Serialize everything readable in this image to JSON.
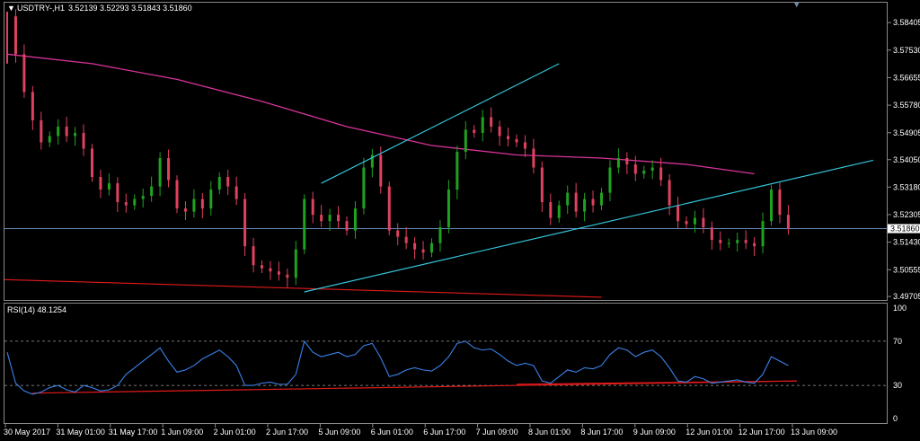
{
  "header": {
    "symbol": "USDTRY-,H1",
    "ohlc": "3.52139 3.52293 3.51843 3.51860"
  },
  "indicator": {
    "label": "RSI(14) 48.1254",
    "levels": [
      100,
      70,
      30,
      0
    ],
    "level_labels": [
      "100",
      "70",
      "30",
      "0"
    ]
  },
  "colors": {
    "background": "#000000",
    "bull": "#1fa31f",
    "bear": "#e0415f",
    "ma": "#d8339a",
    "trendline": "#33c5d8",
    "red_line": "#e31a1a",
    "rsi": "#3a82e8",
    "grid": "#9a9a9a",
    "price_line": "#5f86b2",
    "current_price_bg": "#ffffff"
  },
  "chart_data": {
    "type": "candlestick",
    "title": "USDTRY-,H1",
    "price_ticks": [
      "3.58405",
      "3.57530",
      "3.56655",
      "3.55780",
      "3.54905",
      "3.54050",
      "3.53180",
      "3.52305",
      "3.51430",
      "3.50555",
      "3.49705"
    ],
    "price_values": [
      3.58405,
      3.5753,
      3.56655,
      3.5578,
      3.54905,
      3.5405,
      3.5318,
      3.52305,
      3.5143,
      3.50555,
      3.49705
    ],
    "current_price": "3.51860",
    "ylim": [
      3.4965,
      3.5895
    ],
    "x_labels": [
      "30 May 2017",
      "31 May 01:00",
      "31 May 17:00",
      "1 Jun 09:00",
      "2 Jun 01:00",
      "2 Jun 17:00",
      "5 Jun 09:00",
      "6 Jun 01:00",
      "6 Jun 17:00",
      "7 Jun 09:00",
      "8 Jun 01:00",
      "8 Jun 17:00",
      "9 Jun 09:00",
      "12 Jun 01:00",
      "12 Jun 17:00",
      "13 Jun 09:00"
    ],
    "close_path": [
      [
        0,
        3.586
      ],
      [
        1,
        3.574
      ],
      [
        2,
        3.562
      ],
      [
        3,
        3.553
      ],
      [
        4,
        3.546
      ],
      [
        5,
        3.548
      ],
      [
        6,
        3.551
      ],
      [
        7,
        3.548
      ],
      [
        8,
        3.549
      ],
      [
        9,
        3.544
      ],
      [
        10,
        3.535
      ],
      [
        11,
        3.531
      ],
      [
        12,
        3.533
      ],
      [
        13,
        3.527
      ],
      [
        14,
        3.526
      ],
      [
        15,
        3.528
      ],
      [
        16,
        3.529
      ],
      [
        17,
        3.532
      ],
      [
        18,
        3.541
      ],
      [
        19,
        3.534
      ],
      [
        20,
        3.525
      ],
      [
        21,
        3.524
      ],
      [
        22,
        3.528
      ],
      [
        23,
        3.525
      ],
      [
        24,
        3.531
      ],
      [
        25,
        3.535
      ],
      [
        26,
        3.532
      ],
      [
        27,
        3.528
      ],
      [
        28,
        3.513
      ],
      [
        29,
        3.507
      ],
      [
        30,
        3.506
      ],
      [
        31,
        3.505
      ],
      [
        32,
        3.504
      ],
      [
        33,
        3.503
      ],
      [
        34,
        3.512
      ],
      [
        35,
        3.528
      ],
      [
        36,
        3.523
      ],
      [
        37,
        3.521
      ],
      [
        38,
        3.523
      ],
      [
        39,
        3.521
      ],
      [
        40,
        3.518
      ],
      [
        41,
        3.525
      ],
      [
        42,
        3.538
      ],
      [
        43,
        3.542
      ],
      [
        44,
        3.532
      ],
      [
        45,
        3.518
      ],
      [
        46,
        3.516
      ],
      [
        47,
        3.514
      ],
      [
        48,
        3.512
      ],
      [
        49,
        3.511
      ],
      [
        50,
        3.514
      ],
      [
        51,
        3.519
      ],
      [
        52,
        3.531
      ],
      [
        53,
        3.543
      ],
      [
        54,
        3.55
      ],
      [
        55,
        3.549
      ],
      [
        56,
        3.554
      ],
      [
        57,
        3.551
      ],
      [
        58,
        3.548
      ],
      [
        59,
        3.547
      ],
      [
        60,
        3.546
      ],
      [
        61,
        3.544
      ],
      [
        62,
        3.538
      ],
      [
        63,
        3.527
      ],
      [
        64,
        3.522
      ],
      [
        65,
        3.526
      ],
      [
        66,
        3.53
      ],
      [
        67,
        3.524
      ],
      [
        68,
        3.528
      ],
      [
        69,
        3.526
      ],
      [
        70,
        3.53
      ],
      [
        71,
        3.538
      ],
      [
        72,
        3.541
      ],
      [
        73,
        3.539
      ],
      [
        74,
        3.536
      ],
      [
        75,
        3.537
      ],
      [
        76,
        3.538
      ],
      [
        77,
        3.534
      ],
      [
        78,
        3.526
      ],
      [
        79,
        3.521
      ],
      [
        80,
        3.52
      ],
      [
        81,
        3.522
      ],
      [
        82,
        3.519
      ],
      [
        83,
        3.515
      ],
      [
        84,
        3.514
      ],
      [
        85,
        3.514
      ],
      [
        86,
        3.515
      ],
      [
        87,
        3.514
      ],
      [
        88,
        3.513
      ],
      [
        89,
        3.521
      ],
      [
        90,
        3.531
      ],
      [
        91,
        3.523
      ],
      [
        92,
        3.5186
      ]
    ],
    "ma_path": [
      [
        0,
        3.574
      ],
      [
        10,
        3.571
      ],
      [
        20,
        3.566
      ],
      [
        30,
        3.559
      ],
      [
        40,
        3.551
      ],
      [
        50,
        3.545
      ],
      [
        60,
        3.542
      ],
      [
        70,
        3.541
      ],
      [
        80,
        3.539
      ],
      [
        88,
        3.536
      ]
    ],
    "trendlines": [
      {
        "from": [
          37,
          3.533
        ],
        "to": [
          65,
          3.571
        ]
      },
      {
        "from": [
          35,
          3.4985
        ],
        "to": [
          102,
          3.5403
        ]
      }
    ],
    "red_line": {
      "from": [
        0,
        3.5024
      ],
      "to": [
        70,
        3.4968
      ]
    },
    "rsi_path": [
      [
        0,
        60
      ],
      [
        1,
        32
      ],
      [
        2,
        25
      ],
      [
        3,
        22
      ],
      [
        4,
        24
      ],
      [
        5,
        28
      ],
      [
        6,
        30
      ],
      [
        7,
        26
      ],
      [
        8,
        24
      ],
      [
        9,
        30
      ],
      [
        10,
        28
      ],
      [
        11,
        25
      ],
      [
        12,
        26
      ],
      [
        13,
        30
      ],
      [
        14,
        40
      ],
      [
        15,
        46
      ],
      [
        16,
        52
      ],
      [
        17,
        58
      ],
      [
        18,
        64
      ],
      [
        19,
        52
      ],
      [
        20,
        42
      ],
      [
        21,
        44
      ],
      [
        22,
        48
      ],
      [
        23,
        54
      ],
      [
        24,
        58
      ],
      [
        25,
        62
      ],
      [
        26,
        56
      ],
      [
        27,
        48
      ],
      [
        28,
        30
      ],
      [
        29,
        30
      ],
      [
        30,
        32
      ],
      [
        31,
        33
      ],
      [
        32,
        31
      ],
      [
        33,
        31
      ],
      [
        34,
        40
      ],
      [
        35,
        70
      ],
      [
        36,
        60
      ],
      [
        37,
        56
      ],
      [
        38,
        58
      ],
      [
        39,
        60
      ],
      [
        40,
        56
      ],
      [
        41,
        58
      ],
      [
        42,
        66
      ],
      [
        43,
        68
      ],
      [
        44,
        55
      ],
      [
        45,
        38
      ],
      [
        46,
        40
      ],
      [
        47,
        44
      ],
      [
        48,
        46
      ],
      [
        49,
        44
      ],
      [
        50,
        43
      ],
      [
        51,
        48
      ],
      [
        52,
        56
      ],
      [
        53,
        68
      ],
      [
        54,
        70
      ],
      [
        55,
        64
      ],
      [
        56,
        62
      ],
      [
        57,
        63
      ],
      [
        58,
        58
      ],
      [
        59,
        52
      ],
      [
        60,
        48
      ],
      [
        61,
        50
      ],
      [
        62,
        48
      ],
      [
        63,
        34
      ],
      [
        64,
        32
      ],
      [
        65,
        38
      ],
      [
        66,
        44
      ],
      [
        67,
        42
      ],
      [
        68,
        46
      ],
      [
        69,
        45
      ],
      [
        70,
        48
      ],
      [
        71,
        58
      ],
      [
        72,
        64
      ],
      [
        73,
        62
      ],
      [
        74,
        56
      ],
      [
        75,
        60
      ],
      [
        76,
        62
      ],
      [
        77,
        56
      ],
      [
        78,
        46
      ],
      [
        79,
        34
      ],
      [
        80,
        33
      ],
      [
        81,
        38
      ],
      [
        82,
        36
      ],
      [
        83,
        32
      ],
      [
        84,
        33
      ],
      [
        85,
        34
      ],
      [
        86,
        35
      ],
      [
        87,
        33
      ],
      [
        88,
        32
      ],
      [
        89,
        40
      ],
      [
        90,
        56
      ],
      [
        91,
        52
      ],
      [
        92,
        48
      ]
    ],
    "rsi_trend": {
      "from": [
        3,
        23
      ],
      "to": [
        93,
        34
      ]
    },
    "rsi_trend2": {
      "from": [
        60,
        31
      ],
      "to": [
        93,
        34
      ]
    },
    "rsi_ylim": [
      0,
      100
    ]
  }
}
